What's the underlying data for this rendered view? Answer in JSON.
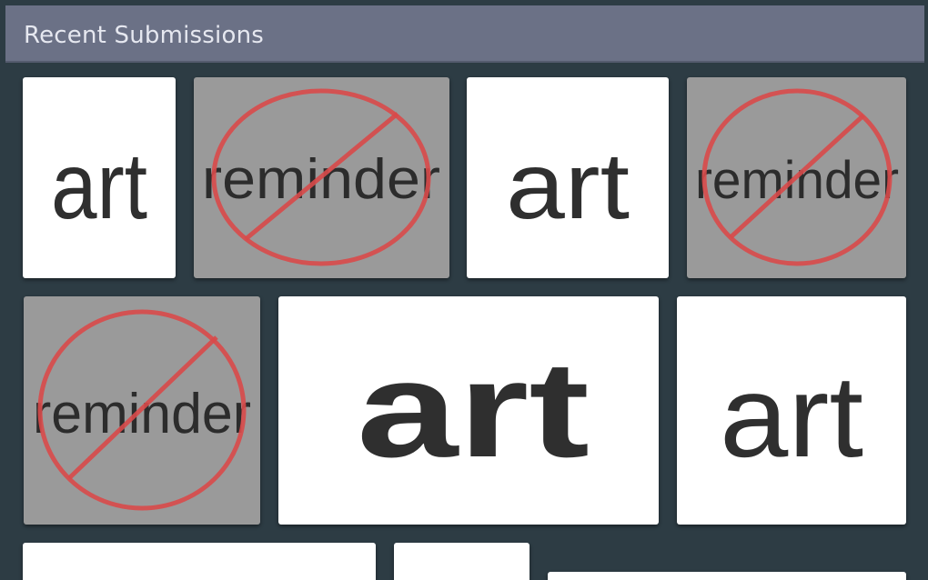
{
  "header": {
    "title": "Recent Submissions"
  },
  "submissions": {
    "art_label": "art",
    "reminder_label": "reminder"
  },
  "colors": {
    "header_bg": "#6b7186",
    "panel_bg": "#2d3c44",
    "prohibit_red": "#d94a4a",
    "reminder_bg": "#9a9a9a"
  }
}
